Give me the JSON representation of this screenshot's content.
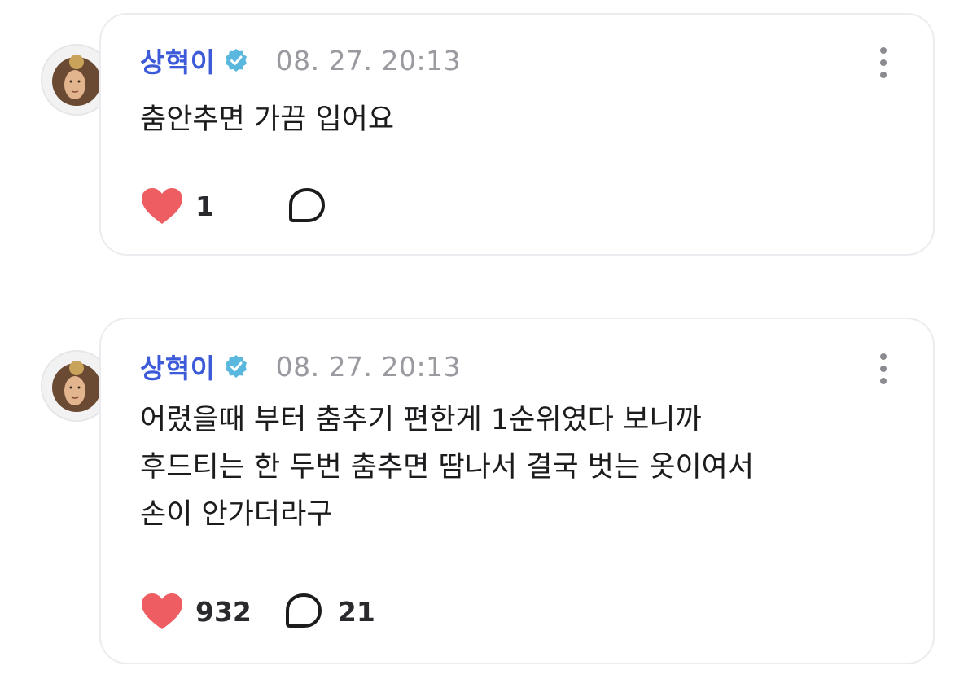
{
  "colors": {
    "author": "#3d5bd9",
    "verified": "#5ab8de",
    "heart": "#ee5d61",
    "timestamp": "#9a9aa0"
  },
  "posts": [
    {
      "author": "상혁이",
      "verified_icon": "verified-badge",
      "timestamp": "08. 27. 20:13",
      "lines": [
        "춤안추면 가끔 입어요"
      ],
      "likes": "1",
      "comments": ""
    },
    {
      "author": "상혁이",
      "verified_icon": "verified-badge",
      "timestamp": "08. 27. 20:13",
      "lines": [
        "어렸을때 부터 춤추기 편한게 1순위였다 보니까",
        "후드티는 한 두번 춤추면 땀나서 결국 벗는 옷이여서",
        "손이 안가더라구"
      ],
      "likes": "932",
      "comments": "21"
    }
  ]
}
